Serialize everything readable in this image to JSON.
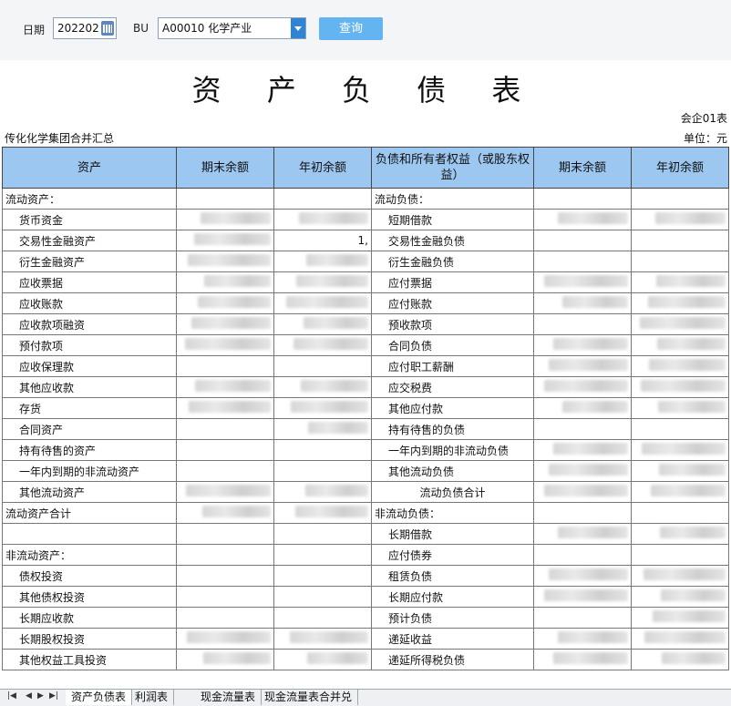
{
  "filters": {
    "date_label": "日期",
    "date_value": "202202",
    "bu_label": "BU",
    "bu_value": "A00010 化学产业",
    "query_label": "查询"
  },
  "report": {
    "title": "资 产 负 债 表",
    "code": "会企01表",
    "company": "传化化学集团合并汇总",
    "unit": "单位：元"
  },
  "columns": [
    "资产",
    "期末余额",
    "年初余额",
    "负债和所有者权益（或股东权益）",
    "期末余额",
    "年初余额"
  ],
  "rows": [
    {
      "a": "流动资产：",
      "ai": false,
      "ae": "",
      "ab": "",
      "l": "流动负债：",
      "li": false,
      "le": "",
      "lb": ""
    },
    {
      "a": "货币资金",
      "ai": true,
      "ae": "blur",
      "ab": "blur",
      "l": "短期借款",
      "li": true,
      "le": "blur",
      "lb": "blur"
    },
    {
      "a": "交易性金融资产",
      "ai": true,
      "ae": "blur",
      "ab": "1,",
      "l": "交易性金融负债",
      "li": true,
      "le": "",
      "lb": ""
    },
    {
      "a": "衍生金融资产",
      "ai": true,
      "ae": "blur",
      "ab": "blur",
      "l": "衍生金融负债",
      "li": true,
      "le": "",
      "lb": ""
    },
    {
      "a": "应收票据",
      "ai": true,
      "ae": "blur",
      "ab": "blur",
      "l": "应付票据",
      "li": true,
      "le": "blur",
      "lb": "blur"
    },
    {
      "a": "应收账款",
      "ai": true,
      "ae": "blur",
      "ab": "blur",
      "l": "应付账款",
      "li": true,
      "le": "blur",
      "lb": "blur"
    },
    {
      "a": "应收款项融资",
      "ai": true,
      "ae": "blur",
      "ab": "blur",
      "l": "预收款项",
      "li": true,
      "le": "",
      "lb": "blur"
    },
    {
      "a": "预付款项",
      "ai": true,
      "ae": "blur",
      "ab": "blur",
      "l": "合同负债",
      "li": true,
      "le": "blur",
      "lb": "blur"
    },
    {
      "a": "应收保理款",
      "ai": true,
      "ae": "",
      "ab": "",
      "l": "应付职工薪酬",
      "li": true,
      "le": "blur",
      "lb": "blur"
    },
    {
      "a": "其他应收款",
      "ai": true,
      "ae": "blur",
      "ab": "blur",
      "l": "应交税费",
      "li": true,
      "le": "blur",
      "lb": "blur"
    },
    {
      "a": "存货",
      "ai": true,
      "ae": "blur",
      "ab": "blur",
      "l": "其他应付款",
      "li": true,
      "le": "blur",
      "lb": "blur"
    },
    {
      "a": "合同资产",
      "ai": true,
      "ae": "",
      "ab": "blur",
      "l": "持有待售的负债",
      "li": true,
      "le": "",
      "lb": ""
    },
    {
      "a": "持有待售的资产",
      "ai": true,
      "ae": "",
      "ab": "",
      "l": "一年内到期的非流动负债",
      "li": true,
      "le": "blur",
      "lb": "blur"
    },
    {
      "a": "一年内到期的非流动资产",
      "ai": true,
      "ae": "",
      "ab": "",
      "l": "其他流动负债",
      "li": true,
      "le": "blur",
      "lb": "blur"
    },
    {
      "a": "其他流动资产",
      "ai": true,
      "ae": "blur",
      "ab": "blur",
      "l": "流动负债合计",
      "li": "center",
      "le": "blur",
      "lb": "blur"
    },
    {
      "a": "流动资产合计",
      "ai": false,
      "ae": "blur",
      "ab": "blur",
      "l": "非流动负债：",
      "li": false,
      "le": "",
      "lb": ""
    },
    {
      "a": "",
      "ai": false,
      "ae": "",
      "ab": "",
      "l": "长期借款",
      "li": true,
      "le": "blur",
      "lb": "blur"
    },
    {
      "a": "非流动资产：",
      "ai": false,
      "ae": "",
      "ab": "",
      "l": "应付债券",
      "li": true,
      "le": "",
      "lb": ""
    },
    {
      "a": "债权投资",
      "ai": true,
      "ae": "",
      "ab": "",
      "l": "租赁负债",
      "li": true,
      "le": "blur",
      "lb": "blur"
    },
    {
      "a": "其他债权投资",
      "ai": true,
      "ae": "",
      "ab": "",
      "l": "长期应付款",
      "li": true,
      "le": "blur",
      "lb": "blur"
    },
    {
      "a": "长期应收款",
      "ai": true,
      "ae": "",
      "ab": "",
      "l": "预计负债",
      "li": true,
      "le": "",
      "lb": "blur"
    },
    {
      "a": "长期股权投资",
      "ai": true,
      "ae": "blur",
      "ab": "blur",
      "l": "递延收益",
      "li": true,
      "le": "blur",
      "lb": "blur"
    },
    {
      "a": "其他权益工具投资",
      "ai": true,
      "ae": "blur",
      "ab": "blur",
      "l": "递延所得税负债",
      "li": true,
      "le": "blur",
      "lb": "blur"
    }
  ],
  "sheet_tabs": [
    "资产负债表",
    "利润表",
    "现金流量表",
    "现金流量表合并兑"
  ]
}
